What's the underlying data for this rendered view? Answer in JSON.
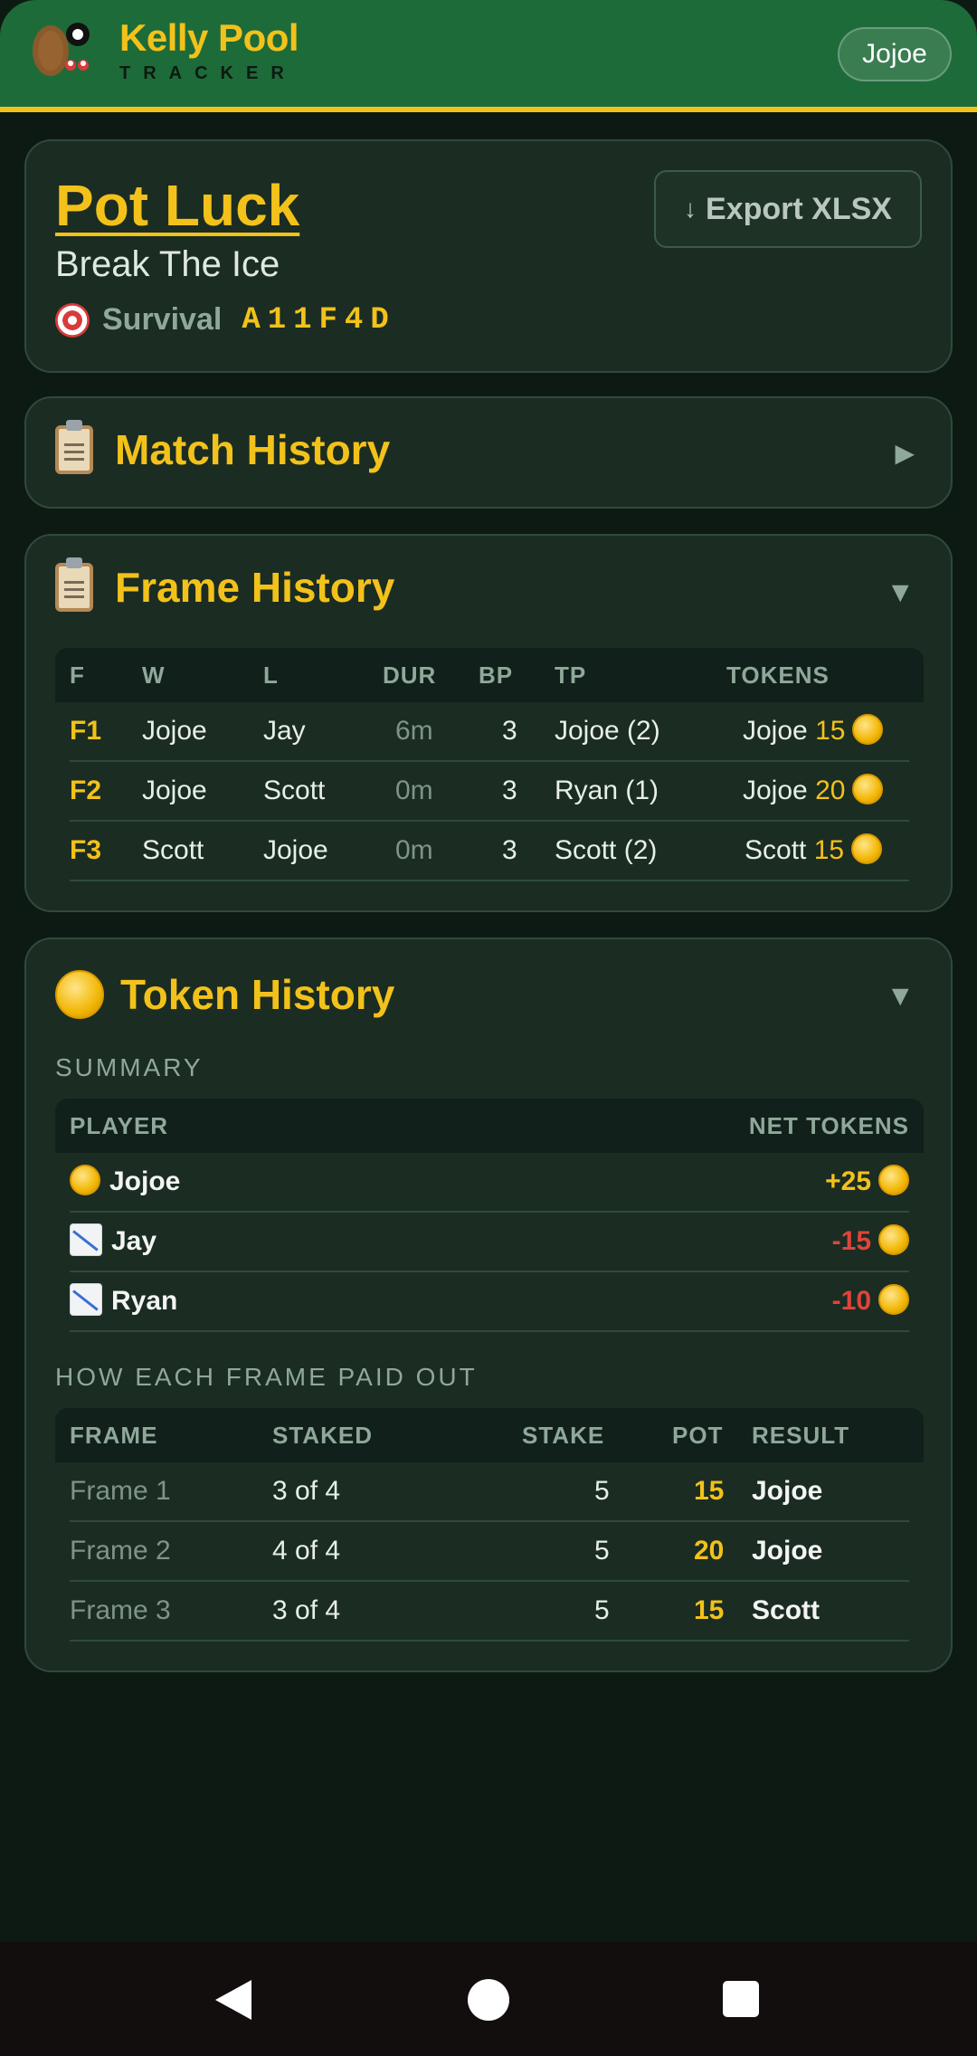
{
  "header": {
    "brand_title": "Kelly Pool",
    "brand_sub": "TRACKER",
    "user": "Jojoe"
  },
  "match": {
    "title": "Pot Luck",
    "subtitle": "Break The Ice",
    "mode": "Survival",
    "code": "A11F4D",
    "export_label": "Export XLSX"
  },
  "match_history": {
    "title": "Match History",
    "chevron": "▶"
  },
  "frame_history": {
    "title": "Frame History",
    "chevron": "▼",
    "columns": [
      "F",
      "W",
      "L",
      "DUR",
      "BP",
      "TP",
      "TOKENS"
    ],
    "rows": [
      {
        "f": "F1",
        "w": "Jojoe",
        "l": "Jay",
        "dur": "6m",
        "bp": "3",
        "tp": "Jojoe (2)",
        "token_player": "Jojoe",
        "token_amount": "15"
      },
      {
        "f": "F2",
        "w": "Jojoe",
        "l": "Scott",
        "dur": "0m",
        "bp": "3",
        "tp": "Ryan (1)",
        "token_player": "Jojoe",
        "token_amount": "20"
      },
      {
        "f": "F3",
        "w": "Scott",
        "l": "Jojoe",
        "dur": "0m",
        "bp": "3",
        "tp": "Scott (2)",
        "token_player": "Scott",
        "token_amount": "15"
      }
    ]
  },
  "token_history": {
    "title": "Token History",
    "chevron": "▼",
    "summary_label": "SUMMARY",
    "summary_columns": [
      "PLAYER",
      "NET TOKENS"
    ],
    "summary_rows": [
      {
        "icon": "coin-icon",
        "player": "Jojoe",
        "net": "+25",
        "status": "gain"
      },
      {
        "icon": "chart-decreasing-icon",
        "player": "Jay",
        "net": "-15",
        "status": "loss"
      },
      {
        "icon": "chart-decreasing-icon",
        "player": "Ryan",
        "net": "-10",
        "status": "loss"
      }
    ],
    "payout_label": "HOW EACH FRAME PAID OUT",
    "payout_columns": [
      "FRAME",
      "STAKED",
      "STAKE",
      "POT",
      "RESULT"
    ],
    "payout_rows": [
      {
        "frame": "Frame 1",
        "staked": "3 of 4",
        "stake": "5",
        "pot": "15",
        "result": "Jojoe"
      },
      {
        "frame": "Frame 2",
        "staked": "4 of 4",
        "stake": "5",
        "pot": "20",
        "result": "Jojoe"
      },
      {
        "frame": "Frame 3",
        "staked": "3 of 4",
        "stake": "5",
        "pot": "15",
        "result": "Scott"
      }
    ]
  },
  "colors": {
    "accent": "#f2c21b",
    "header_green": "#1e6b3a",
    "background": "#0d1a13",
    "card": "#1b2c22",
    "loss_red": "#e0443a"
  }
}
